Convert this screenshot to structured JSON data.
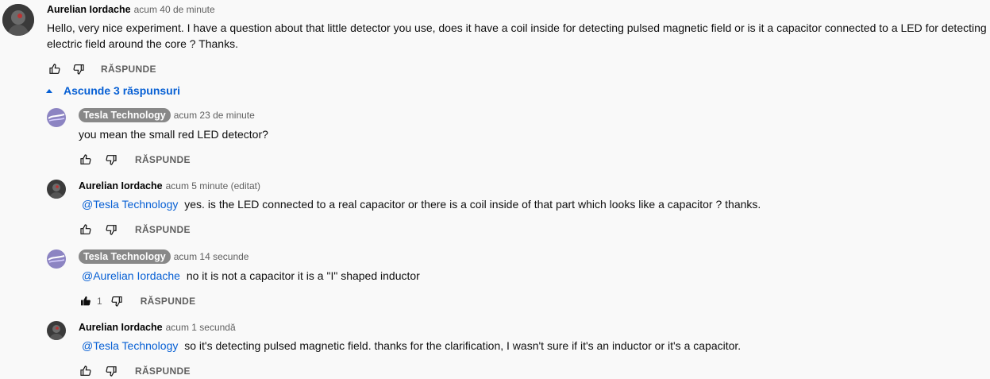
{
  "main_comment": {
    "author": "Aurelian Iordache",
    "time": "acum 40 de minute",
    "text": "Hello, very nice experiment. I have a question about that little detector you use, does it have a coil inside for detecting pulsed magnetic field or is it a capacitor connected to a LED for detecting electric field around the core ? Thanks.",
    "reply_label": "RĂSPUNDE"
  },
  "toggle_replies": {
    "label": "Ascunde 3 răspunsuri"
  },
  "replies": [
    {
      "author": "Tesla Technology",
      "time": "acum 23 de minute",
      "mention": "",
      "text": "you mean the small red LED detector?",
      "likes": "",
      "reply_label": "RĂSPUNDE"
    },
    {
      "author": "Aurelian Iordache",
      "time": "acum 5 minute (editat)",
      "mention": "@Tesla Technology",
      "text": "yes. is the LED connected to a real capacitor or there is a coil inside of that part which looks like a capacitor ? thanks.",
      "likes": "",
      "reply_label": "RĂSPUNDE"
    },
    {
      "author": "Tesla Technology",
      "time": "acum 14 secunde",
      "mention": "@Aurelian Iordache",
      "text": "no it is not a capacitor it is a \"I\" shaped inductor",
      "likes": "1",
      "reply_label": "RĂSPUNDE"
    },
    {
      "author": "Aurelian Iordache",
      "time": "acum 1 secundă",
      "mention": "@Tesla Technology",
      "text": "so it's detecting pulsed magnetic field. thanks for the clarification, I wasn't sure if it's an inductor or it's a capacitor.",
      "likes": "",
      "reply_label": "RĂSPUNDE"
    }
  ],
  "icons": {
    "like": "thumbs-up-icon",
    "like_filled": "thumbs-up-filled-icon",
    "dislike": "thumbs-down-icon",
    "caret": "caret-up-icon"
  },
  "colors": {
    "link": "#065fd4",
    "meta": "#606060",
    "chip": "#888888"
  }
}
